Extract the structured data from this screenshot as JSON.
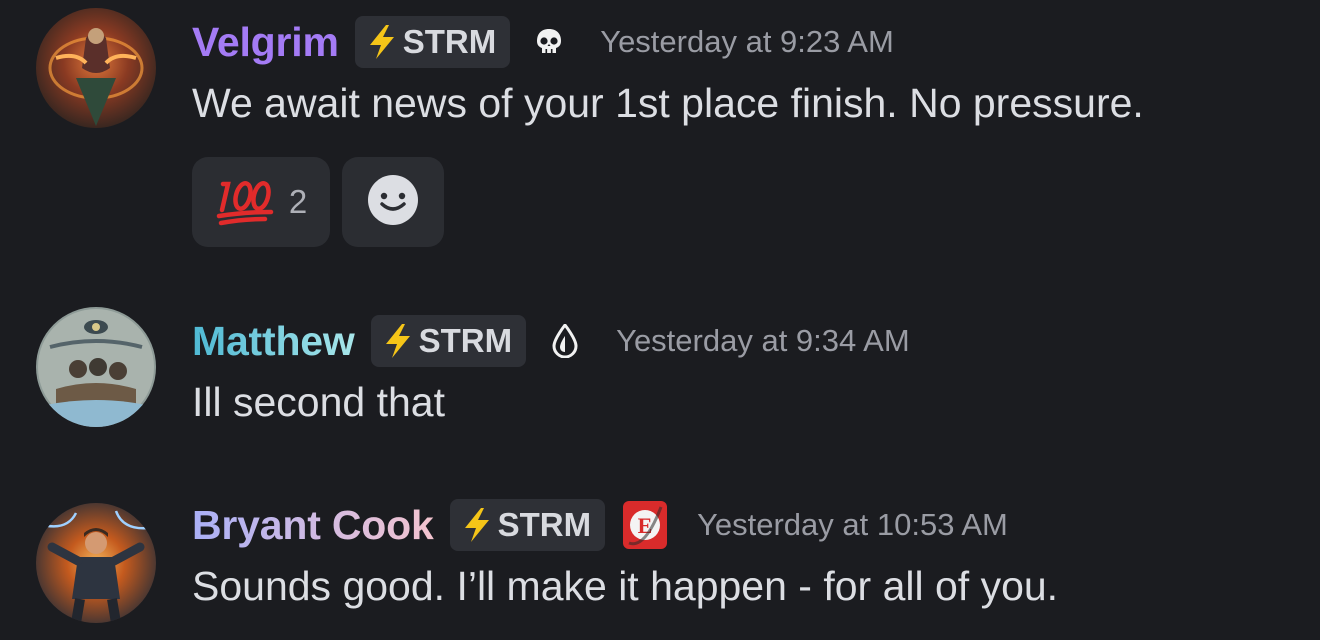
{
  "messages": [
    {
      "username": "Velgrim",
      "username_color": "#a47bf5",
      "tag": "STRM",
      "role_icon": "skull-icon",
      "timestamp": "Yesterday at 9:23 AM",
      "content": "We await news of your 1st place finish. No pressure.",
      "reactions": [
        {
          "emoji": "100-emoji",
          "count": "2"
        }
      ],
      "add_reaction_icon": "smiley-icon"
    },
    {
      "username": "Matthew",
      "username_color": "#5fc4d8",
      "tag": "STRM",
      "role_icon": "water-drop-icon",
      "timestamp": "Yesterday at 9:34 AM",
      "content": "Ill second that"
    },
    {
      "username": "Bryant Cook",
      "username_color_start": "#b3b3f5",
      "username_color_end": "#f2bfcf",
      "tag": "STRM",
      "role_icon": "e-badge-icon",
      "timestamp": "Yesterday at 10:53 AM",
      "content": "Sounds good. I’ll make it happen - for all of you."
    }
  ],
  "colors": {
    "background": "#1b1c20",
    "tag_background": "#2e3036",
    "timestamp": "#9a9ca4",
    "bolt": "#f5c518"
  }
}
